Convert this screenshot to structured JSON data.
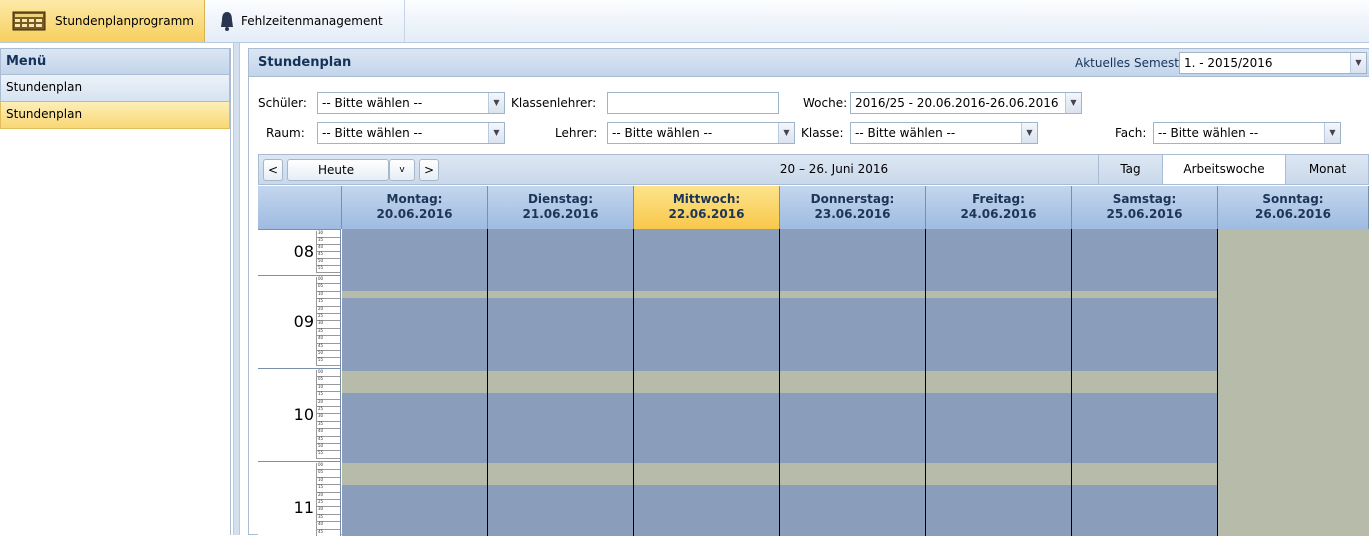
{
  "topbar": {
    "tab1_label": "Stundenplanprogramm",
    "tab2_label": "Fehlzeitenmanagement"
  },
  "sidebar": {
    "title": "Menü",
    "items": [
      {
        "label": "Stundenplan"
      },
      {
        "label": "Stundenplan"
      }
    ]
  },
  "main": {
    "title": "Stundenplan",
    "semester_label": "Aktuelles Semester:",
    "semester_value": "1. - 2015/2016"
  },
  "filters": {
    "schueler_label": "Schüler:",
    "schueler_value": "-- Bitte wählen --",
    "klassenlehrer_label": "Klassenlehrer:",
    "klassenlehrer_value": "",
    "woche_label": "Woche:",
    "woche_value": "2016/25 - 20.06.2016-26.06.2016",
    "raum_label": "Raum:",
    "raum_value": "-- Bitte wählen --",
    "lehrer_label": "Lehrer:",
    "lehrer_value": "-- Bitte wählen --",
    "klasse_label": "Klasse:",
    "klasse_value": "-- Bitte wählen --",
    "fach_label": "Fach:",
    "fach_value": "-- Bitte wählen --"
  },
  "nav": {
    "prev": "<",
    "today": "Heute",
    "dropdown": "v",
    "next": ">",
    "range": "20 – 26. Juni 2016",
    "views": [
      "Tag",
      "Arbeitswoche",
      "Monat"
    ],
    "active_view": "Arbeitswoche"
  },
  "calendar": {
    "days": [
      {
        "name": "Montag:",
        "date": "20.06.2016"
      },
      {
        "name": "Dienstag:",
        "date": "21.06.2016"
      },
      {
        "name": "Mittwoch:",
        "date": "22.06.2016"
      },
      {
        "name": "Donnerstag:",
        "date": "23.06.2016"
      },
      {
        "name": "Freitag:",
        "date": "24.06.2016"
      },
      {
        "name": "Samstag:",
        "date": "25.06.2016"
      },
      {
        "name": "Sonntag:",
        "date": "26.06.2016"
      }
    ],
    "today_index": 2,
    "hours": [
      "08",
      "09",
      "10",
      "11"
    ],
    "tick_labels_08": [
      "30",
      "35",
      "40",
      "45",
      "50",
      "55"
    ],
    "tick_labels_full": [
      "00",
      "05",
      "10",
      "15",
      "20",
      "25",
      "30",
      "35",
      "40",
      "45",
      "50",
      "55"
    ],
    "colors": {
      "slot": "#8a9dba",
      "break": "#b7bbaa",
      "today_header": "#f8c84b"
    }
  }
}
